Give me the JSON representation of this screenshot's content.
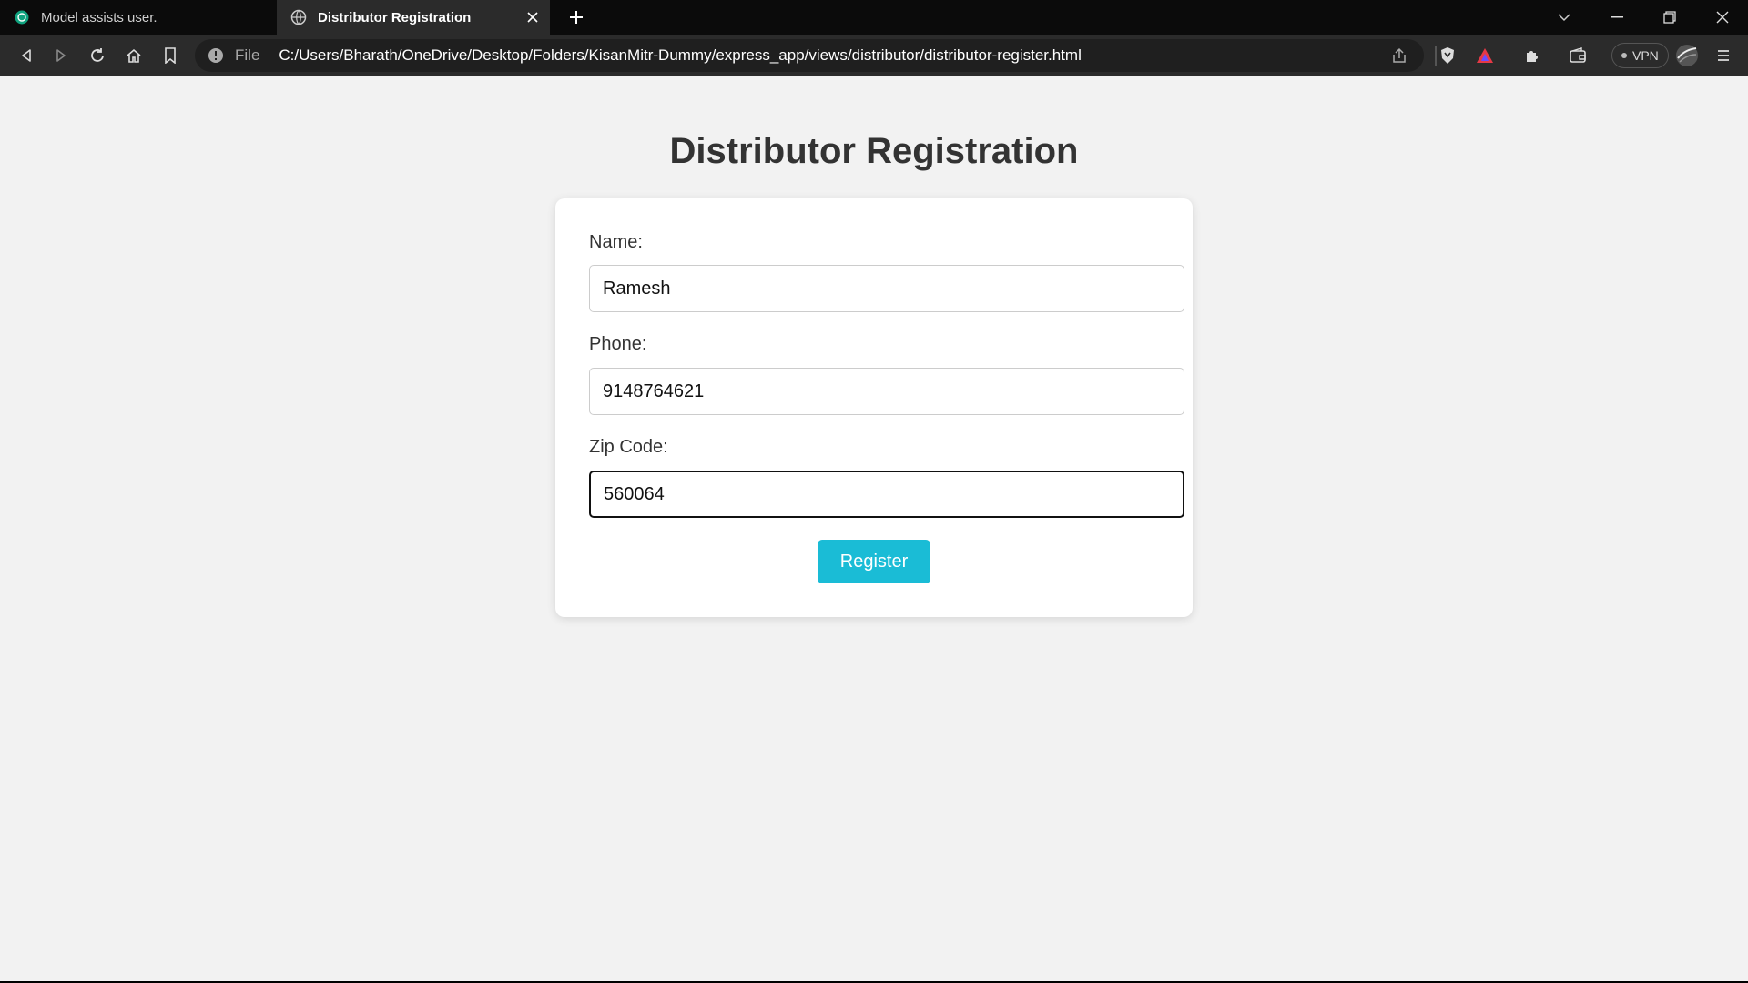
{
  "browser": {
    "tabs": [
      {
        "title": "Model assists user.",
        "icon": "openai-icon",
        "active": false
      },
      {
        "title": "Distributor Registration",
        "icon": "globe-icon",
        "active": true
      }
    ],
    "address": {
      "scheme_label": "File",
      "url": "C:/Users/Bharath/OneDrive/Desktop/Folders/KisanMitr-Dummy/express_app/views/distributor/distributor-register.html"
    },
    "vpn_label": "VPN"
  },
  "page": {
    "title": "Distributor Registration",
    "form": {
      "name_label": "Name:",
      "name_value": "Ramesh",
      "phone_label": "Phone:",
      "phone_value": "9148764621",
      "zip_label": "Zip Code:",
      "zip_value": "560064",
      "submit_label": "Register"
    },
    "colors": {
      "accent": "#1abcd6",
      "page_bg": "#f2f2f2"
    }
  }
}
